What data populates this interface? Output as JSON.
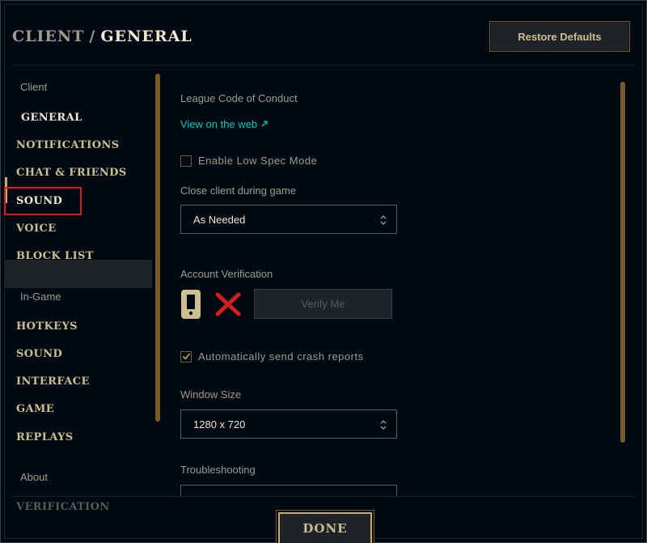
{
  "header": {
    "section": "CLIENT",
    "separator": "/",
    "page": "GENERAL",
    "restore_label": "Restore Defaults"
  },
  "sidebar": {
    "group_client": "Client",
    "client_items": [
      "GENERAL",
      "NOTIFICATIONS",
      "CHAT & FRIENDS",
      "SOUND",
      "VOICE",
      "BLOCK LIST"
    ],
    "group_ingame": "In-Game",
    "ingame_items": [
      "HOTKEYS",
      "SOUND",
      "INTERFACE",
      "GAME",
      "REPLAYS"
    ],
    "group_about": "About",
    "about_items": [
      "VERIFICATION"
    ],
    "active_item": "GENERAL",
    "highlighted_item": "SOUND"
  },
  "main": {
    "conduct_label": "League Code of Conduct",
    "conduct_link": "View on the web",
    "low_spec_label": "Enable Low Spec Mode",
    "low_spec_checked": false,
    "close_client_label": "Close client during game",
    "close_client_value": "As Needed",
    "account_verification_label": "Account Verification",
    "verify_button": "Verify Me",
    "crash_reports_label": "Automatically send crash reports",
    "crash_reports_checked": true,
    "window_size_label": "Window Size",
    "window_size_value": "1280 x 720",
    "troubleshooting_label": "Troubleshooting"
  },
  "footer": {
    "done_label": "DONE"
  },
  "colors": {
    "gold": "#c8aa6e",
    "gold_dark": "#785a28",
    "link": "#0ac8b9",
    "highlight_red": "#d11f1f",
    "background": "#010a13"
  },
  "icons": {
    "link_arrow": "external-link-icon",
    "phone": "phone-icon",
    "status": "x-icon",
    "select_chevron": "chevron-updown-icon",
    "check": "checkmark-icon"
  }
}
